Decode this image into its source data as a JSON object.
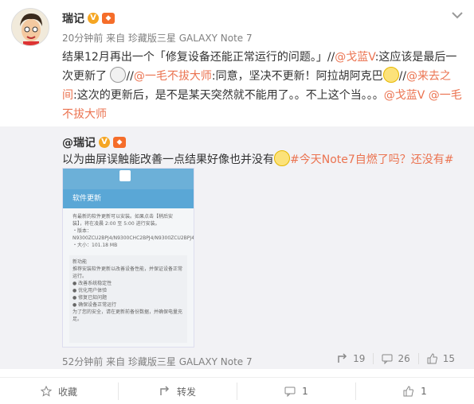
{
  "post": {
    "username": "瑞记",
    "meta": "20分钟前 来自 珍藏版三星 GALAXY Note 7",
    "text_parts": [
      "结果12月再出一个「修复设备还能正常运行的问题。」//",
      "@戈蓝V",
      ":这应该是最后一次更新了",
      "//",
      "@一毛不拔大师",
      ":同意，坚决不更新！阿拉胡阿克巴",
      "//",
      "@来去之间",
      ":这次的更新后，是不是某天突然就不能用了。。不上这个当。。。",
      "@戈蓝V",
      " ",
      "@一毛不拔大师"
    ]
  },
  "repost": {
    "username": "@瑞记",
    "text": "以为曲屏误触能改善一点结果好像也并没有",
    "hashtag": "#今天Note7自燃了吗？还没有#",
    "meta": "52分钟前 来自 珍藏版三星 GALAXY Note 7",
    "actions": {
      "repost_count": "19",
      "comment_count": "26",
      "like_count": "15"
    },
    "screenshot": {
      "title": "软件更新",
      "line1": "有最新的软件更新可以安装。如果点击【稍后安装】，将在凌晨 2:00 至 5:00 进行安装。",
      "version": "・版本：N9300ZCU2BPJ4/N9300CHC2BPJ4/N9300ZCU2BPJ4",
      "size": "・大小：101.18 MB",
      "new_title": "新功能",
      "new_body": "推荐安装软件更新以改善设备性能，并保证设备正常运行。",
      "items": [
        "● 改善系统稳定性",
        "● 优化用户体验",
        "● 修复已知问题",
        "● 确保设备正常运行"
      ],
      "footer": "为了您的安全，请在更新前备份数据，并确保电量充足。"
    }
  },
  "bottom": {
    "favorite_label": "收藏",
    "forward_label": "转发",
    "comment_count": "1",
    "like_count": "1"
  }
}
